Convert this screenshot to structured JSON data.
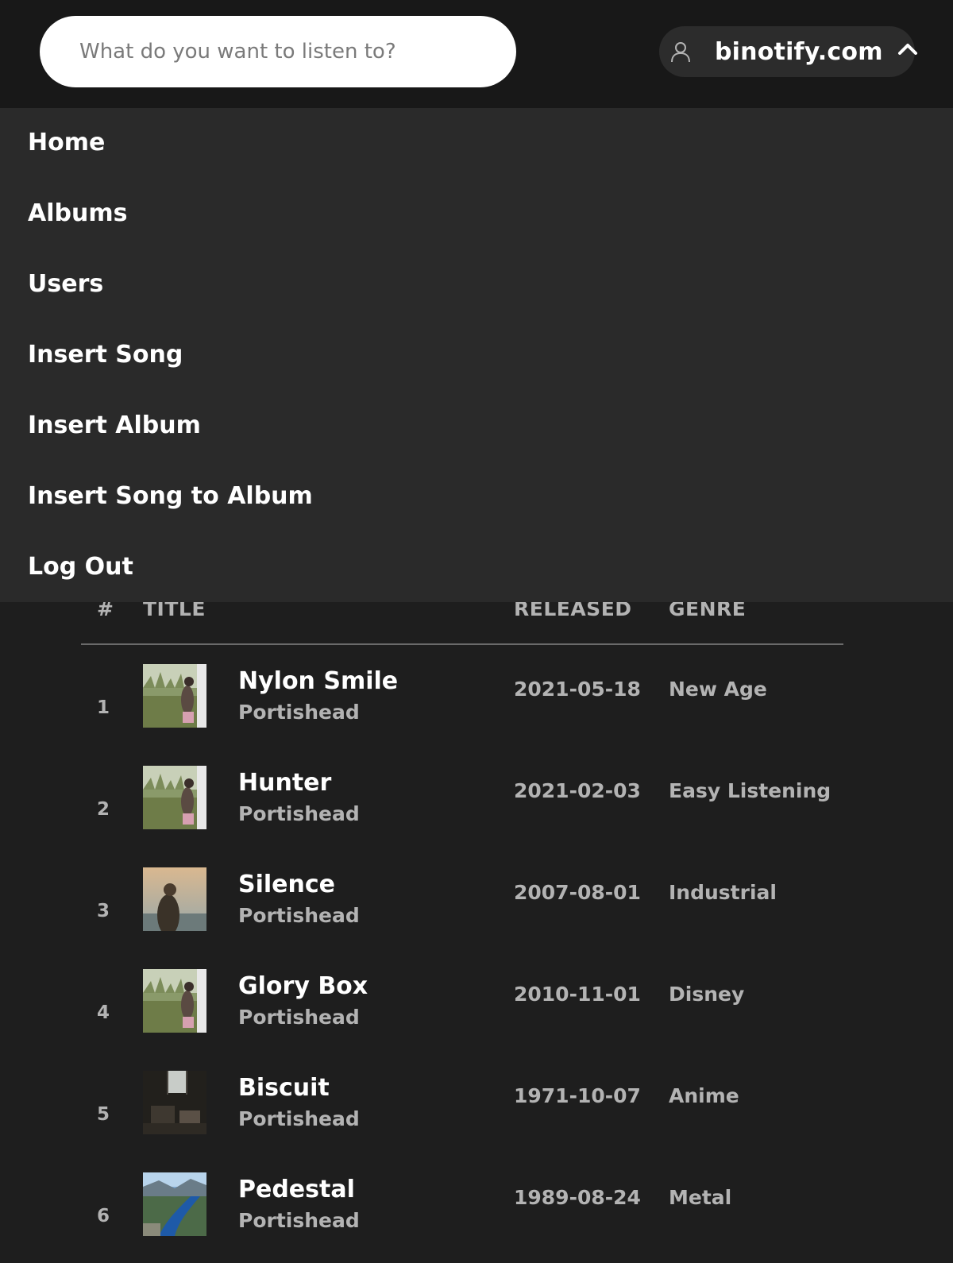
{
  "search": {
    "placeholder": "What do you want to listen to?"
  },
  "account": {
    "site": "binotify.com",
    "user_icon": "user-icon",
    "chevron_icon": "chevron-up-icon"
  },
  "nav": {
    "items": [
      {
        "label": "Home"
      },
      {
        "label": "Albums"
      },
      {
        "label": "Users"
      },
      {
        "label": "Insert Song"
      },
      {
        "label": "Insert Album"
      },
      {
        "label": "Insert Song to Album"
      },
      {
        "label": "Log Out"
      }
    ]
  },
  "table": {
    "headers": {
      "num": "#",
      "title": "TITLE",
      "released": "RELEASED",
      "genre": "GENRE"
    },
    "rows": [
      {
        "num": "1",
        "title": "Nylon Smile",
        "artist": "Portishead",
        "released": "2021-05-18",
        "genre": "New Age",
        "art": "field-girl"
      },
      {
        "num": "2",
        "title": "Hunter",
        "artist": "Portishead",
        "released": "2021-02-03",
        "genre": "Easy Listening",
        "art": "field-girl"
      },
      {
        "num": "3",
        "title": "Silence",
        "artist": "Portishead",
        "released": "2007-08-01",
        "genre": "Industrial",
        "art": "sunset-person"
      },
      {
        "num": "4",
        "title": "Glory Box",
        "artist": "Portishead",
        "released": "2010-11-01",
        "genre": "Disney",
        "art": "field-girl"
      },
      {
        "num": "5",
        "title": "Biscuit",
        "artist": "Portishead",
        "released": "1971-10-07",
        "genre": "Anime",
        "art": "dark-room"
      },
      {
        "num": "6",
        "title": "Pedestal",
        "artist": "Portishead",
        "released": "1989-08-24",
        "genre": "Metal",
        "art": "fjord"
      }
    ]
  },
  "colors": {
    "background": "#1e1e1e",
    "topbar": "#181818",
    "dropdown": "#2a2a2a",
    "text_primary": "#ffffff",
    "text_secondary": "#b3b3b3"
  }
}
